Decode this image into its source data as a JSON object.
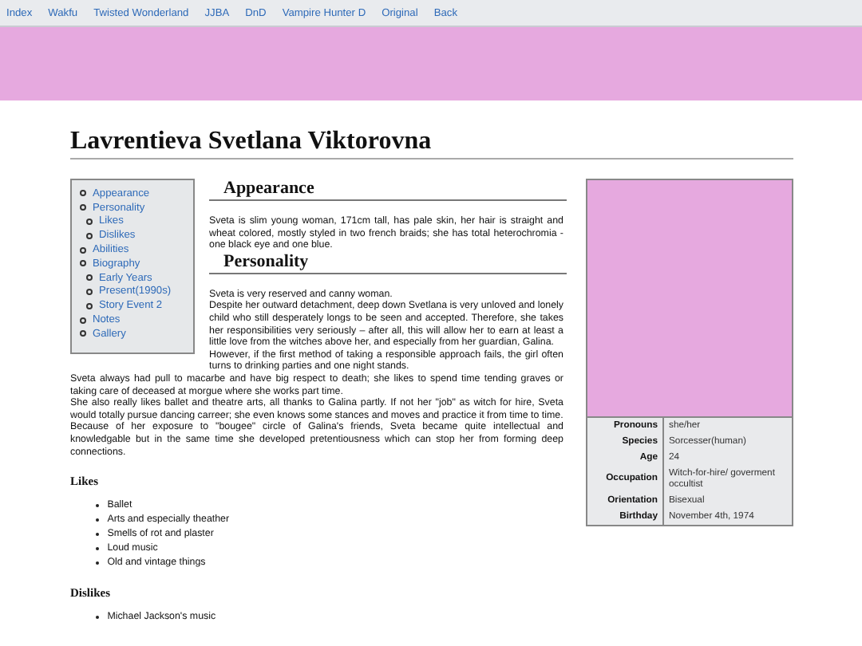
{
  "nav": [
    "Index",
    "Wakfu",
    "Twisted Wonderland",
    "JJBA",
    "DnD",
    "Vampire Hunter D",
    "Original",
    "Back"
  ],
  "title": "Lavrentieva Svetlana Viktorovna",
  "toc": [
    {
      "label": "Appearance"
    },
    {
      "label": "Personality",
      "children": [
        {
          "label": "Likes"
        },
        {
          "label": "Dislikes"
        }
      ]
    },
    {
      "label": "Abilities"
    },
    {
      "label": "Biography",
      "children": [
        {
          "label": "Early Years"
        },
        {
          "label": "Present(1990s)"
        },
        {
          "label": "Story Event 2"
        }
      ]
    },
    {
      "label": "Notes"
    },
    {
      "label": "Gallery"
    }
  ],
  "infobox": {
    "rows": [
      {
        "label": "Pronouns",
        "value": "she/her"
      },
      {
        "label": "Species",
        "value": "Sorcesser(human)"
      },
      {
        "label": "Age",
        "value": "24"
      },
      {
        "label": "Occupation",
        "value": "Witch-for-hire/ goverment occultist"
      },
      {
        "label": "Orientation",
        "value": "Bisexual"
      },
      {
        "label": "Birthday",
        "value": "November 4th, 1974"
      }
    ]
  },
  "sections": [
    {
      "kind": "major",
      "heading": "Appearance",
      "paragraphs": [
        "Sveta is slim young woman, 171cm tall, has pale skin, her hair is straight and wheat colored, mostly styled in two french braids; she has total heterochromia - one black eye and one blue."
      ]
    },
    {
      "kind": "major",
      "heading": "Personality",
      "paragraphs": [
        "Sveta is very reserved and canny woman.",
        "Despite her outward detachment, deep down Svetlana is very unloved and lonely child who still desperately longs to be seen and accepted. Therefore, she takes her responsibilities very seriously – after all, this will allow her to earn at least a little love from the witches above her, and especially from her guardian, Galina.",
        "However, if the first method of taking a responsible approach fails, the girl often turns to drinking parties and one night stands.",
        "Sveta always had pull to macarbe and have big respect to death; she likes to spend time tending graves or taking care of deceased at morgue where she works part time.",
        "She also really likes ballet and theatre arts, all thanks to Galina partly. If not her \"job\" as witch for hire, Sveta would totally pursue dancing carreer; she even knows some stances and moves and practice it from time to time.",
        "Because of her exposure to \"bougee\" circle of Galina's friends, Sveta became quite intellectual and knowledgable but in the same time she developed pretentiousness which can stop her from forming deep connections."
      ]
    },
    {
      "kind": "minor",
      "heading": "Likes",
      "items": [
        "Ballet",
        "Arts and especially theather",
        "Smells of rot and plaster",
        "Loud music",
        "Old and vintage things"
      ]
    },
    {
      "kind": "minor",
      "heading": "Dislikes",
      "items": [
        "Michael Jackson's music"
      ]
    }
  ]
}
